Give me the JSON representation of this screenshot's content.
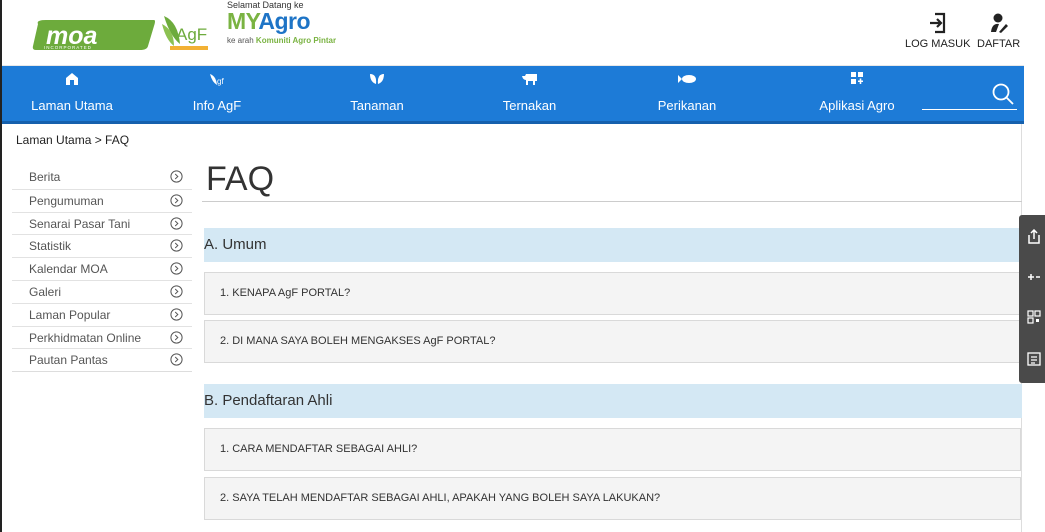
{
  "header": {
    "logo_text": "moa",
    "logo_sub": "INCORPORATED",
    "agf_logo_text": "AgF",
    "myagro_welcome": "Selamat Datang ke",
    "myagro_brand_my": "MY",
    "myagro_brand_agro": "Agro",
    "myagro_tag_prefix": "ke arah",
    "myagro_tag_bold": "Komuniti Agro Pintar",
    "login_label": "LOG MASUK",
    "register_label": "DAFTAR"
  },
  "nav": {
    "items": [
      {
        "label": "Laman Utama",
        "icon": "home-icon"
      },
      {
        "label": "Info AgF",
        "icon": "agf-icon"
      },
      {
        "label": "Tanaman",
        "icon": "leaf-icon"
      },
      {
        "label": "Ternakan",
        "icon": "cow-icon"
      },
      {
        "label": "Perikanan",
        "icon": "fish-icon"
      },
      {
        "label": "Aplikasi Agro",
        "icon": "apps-icon"
      }
    ],
    "search_icon": "search-icon"
  },
  "breadcrumb": "Laman Utama > FAQ",
  "sidebar": {
    "items": [
      {
        "label": "Berita"
      },
      {
        "label": "Pengumuman"
      },
      {
        "label": "Senarai Pasar Tani"
      },
      {
        "label": "Statistik"
      },
      {
        "label": "Kalendar MOA"
      },
      {
        "label": "Galeri"
      },
      {
        "label": "Laman Popular"
      },
      {
        "label": "Perkhidmatan Online"
      },
      {
        "label": "Pautan Pantas"
      }
    ]
  },
  "main": {
    "title": "FAQ",
    "sections": [
      {
        "heading": "A. Umum",
        "questions": [
          "1. KENAPA AgF PORTAL?",
          "2. DI MANA SAYA BOLEH MENGAKSES AgF PORTAL?"
        ]
      },
      {
        "heading": "B. Pendaftaran Ahli",
        "questions": [
          "1. CARA MENDAFTAR SEBAGAI AHLI?",
          "2. SAYA TELAH MENDAFTAR SEBAGAI AHLI, APAKAH YANG BOLEH SAYA LAKUKAN?"
        ]
      }
    ]
  },
  "colors": {
    "nav_blue": "#1d7bd7",
    "section_blue": "#d4e8f4",
    "brand_green": "#7ab342",
    "moa_green": "#6dab3c"
  }
}
